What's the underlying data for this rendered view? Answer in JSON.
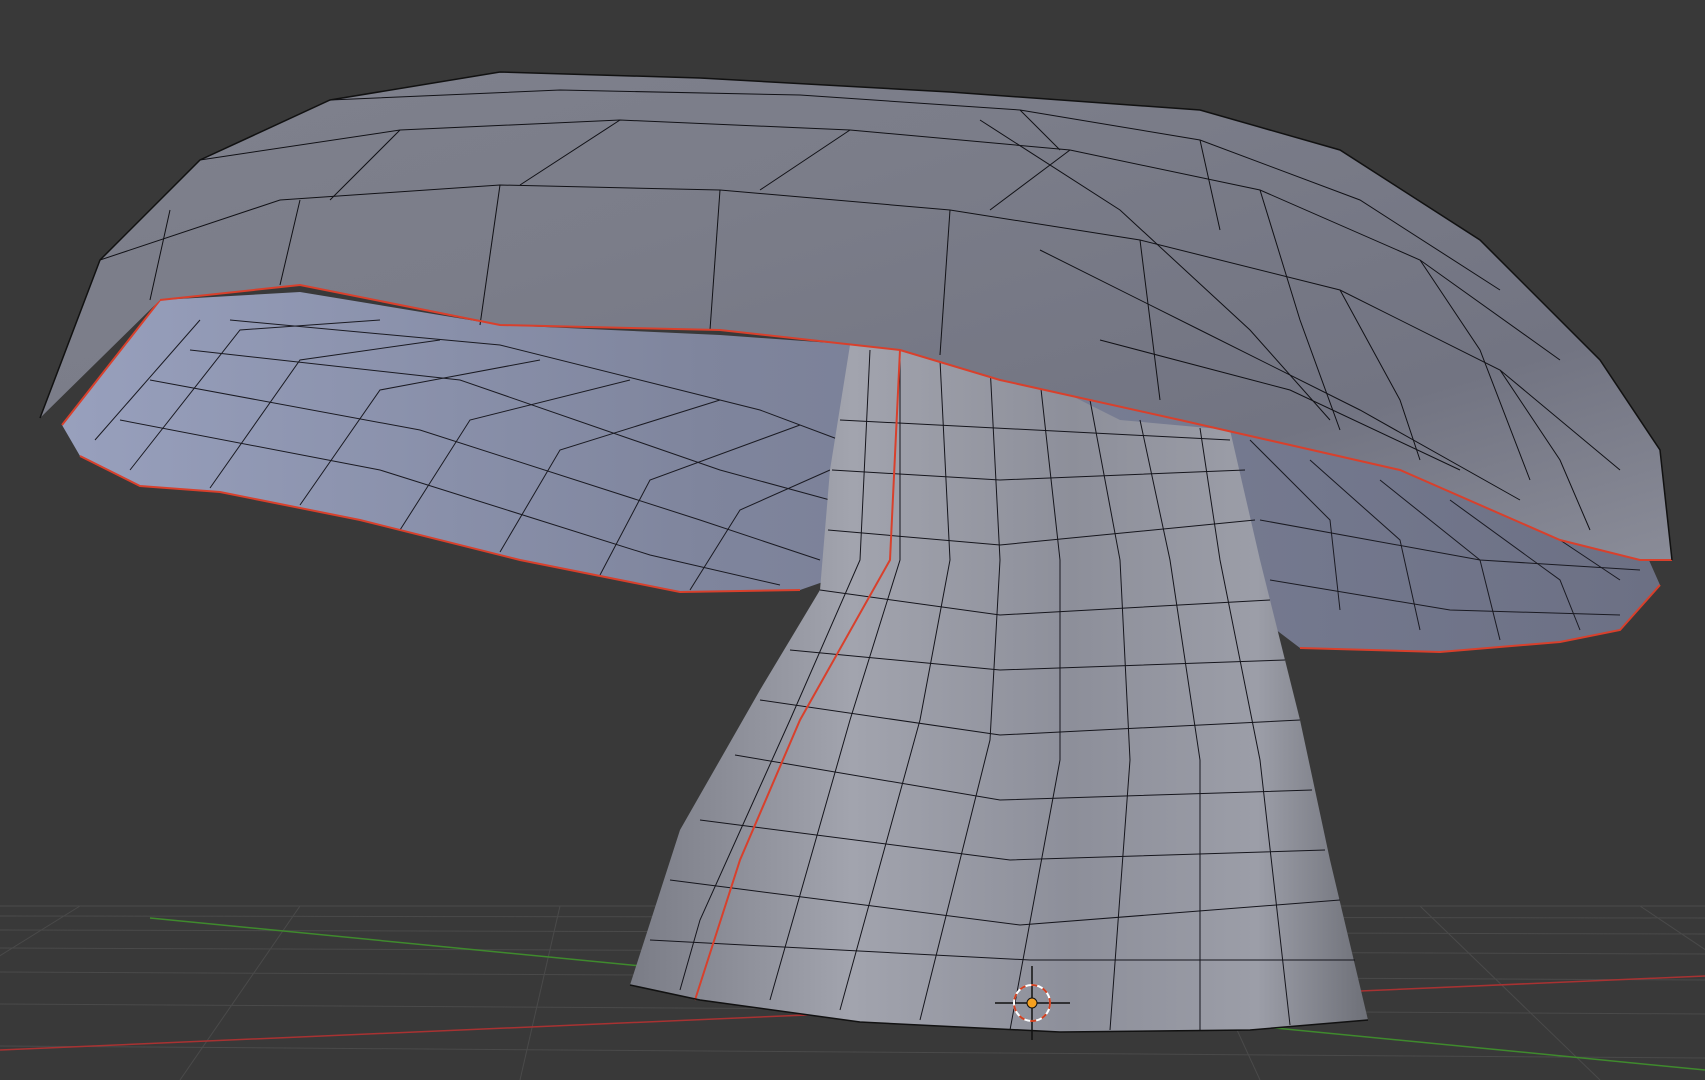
{
  "viewport": {
    "background_color": "#393939",
    "grid_color": "#4a4a4a",
    "x_axis_color": "#a83232",
    "y_axis_color": "#3f8a2d"
  },
  "mesh": {
    "object_name": "mushroom",
    "face_color": "#8b8d99",
    "edge_color": "#111111",
    "seam_color": "#d8402c"
  },
  "cursor": {
    "icon": "3d-cursor-icon",
    "ring_color": "#ffffff",
    "accent_color": "#d04020",
    "origin_color": "#f5a020"
  }
}
